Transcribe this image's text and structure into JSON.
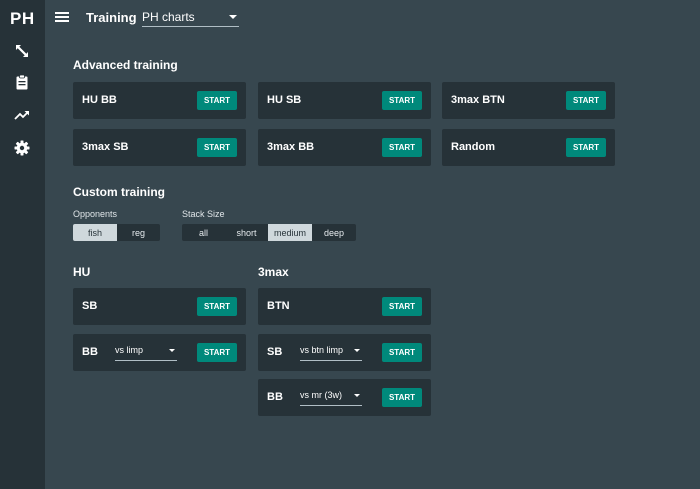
{
  "app": {
    "logo": "PH"
  },
  "sidebar": {
    "icons": [
      "expand-arrows-icon",
      "clipboard-icon",
      "trending-up-icon",
      "gear-icon"
    ]
  },
  "header": {
    "title": "Training",
    "chart_select": "PH charts"
  },
  "advanced": {
    "title": "Advanced training",
    "cards": [
      {
        "name": "HU BB",
        "button": "START"
      },
      {
        "name": "HU SB",
        "button": "START"
      },
      {
        "name": "3max BTN",
        "button": "START"
      },
      {
        "name": "3max SB",
        "button": "START"
      },
      {
        "name": "3max BB",
        "button": "START"
      },
      {
        "name": "Random",
        "button": "START"
      }
    ]
  },
  "custom": {
    "title": "Custom training",
    "opponents": {
      "label": "Opponents",
      "options": [
        "fish",
        "reg"
      ],
      "selected": "fish"
    },
    "stack": {
      "label": "Stack Size",
      "options": [
        "all",
        "short",
        "medium",
        "deep"
      ],
      "selected": "medium"
    }
  },
  "hu": {
    "title": "HU",
    "rows": [
      {
        "name": "SB",
        "select": "",
        "button": "START"
      },
      {
        "name": "BB",
        "select": "vs limp",
        "button": "START"
      }
    ]
  },
  "threemax": {
    "title": "3max",
    "rows": [
      {
        "name": "BTN",
        "select": "",
        "button": "START"
      },
      {
        "name": "SB",
        "select": "vs btn limp",
        "button": "START"
      },
      {
        "name": "BB",
        "select": "vs mr (3w)",
        "button": "START"
      }
    ]
  },
  "colors": {
    "accent": "#00897b",
    "background": "#37474f",
    "card": "#263238",
    "toggle_active": "#cfd8dc"
  }
}
